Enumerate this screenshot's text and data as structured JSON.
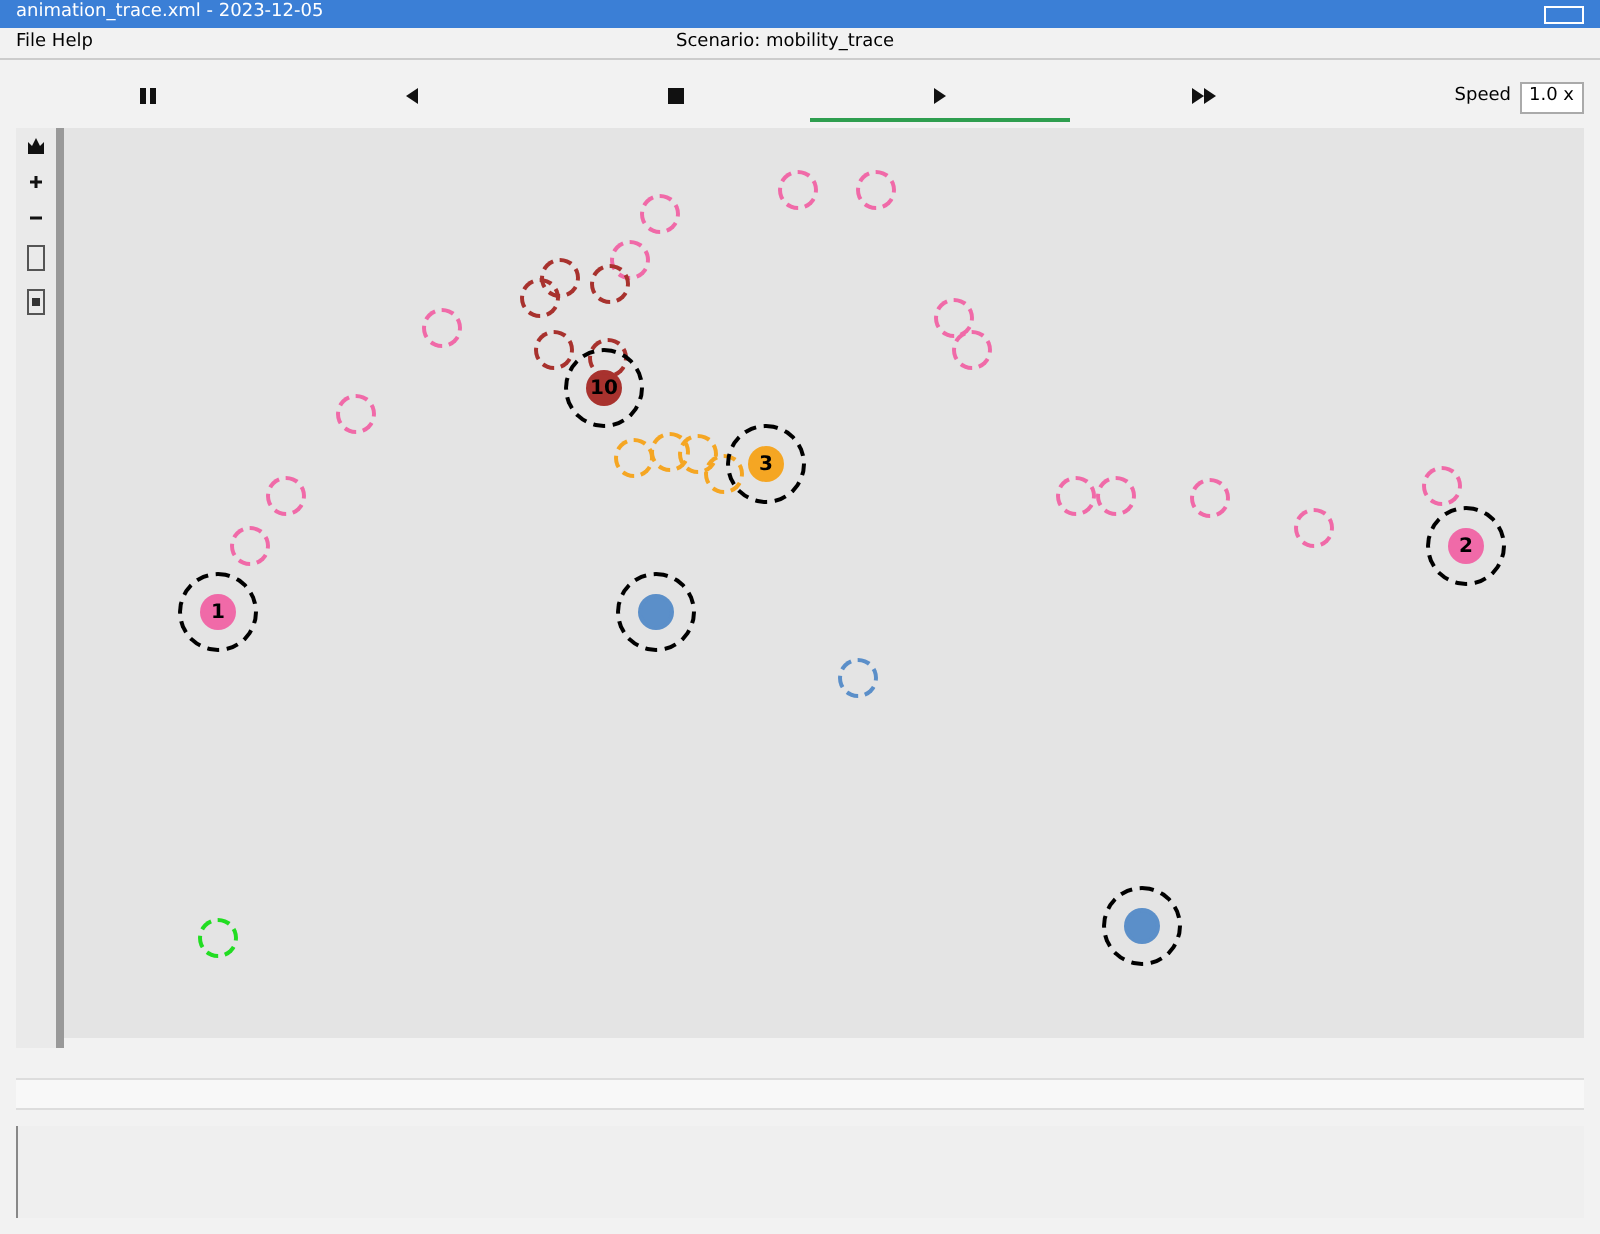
{
  "window": {
    "title": "animation_trace.xml - 2023-12-05"
  },
  "menu": {
    "left": "File  Help",
    "center": "Scenario: mobility_trace"
  },
  "toolbar": [
    {
      "kind": "pause",
      "selected": false
    },
    {
      "kind": "back",
      "selected": false
    },
    {
      "kind": "stop",
      "selected": false
    },
    {
      "kind": "play",
      "selected": true
    },
    {
      "kind": "forward",
      "selected": false
    }
  ],
  "speed": {
    "label": "Speed",
    "value": "1.0 x"
  },
  "nodes": [
    {
      "color": "#f06aa8",
      "filled": false,
      "ringed": false
    },
    {
      "color": "#f06aa8",
      "filled": false,
      "ringed": false
    },
    {
      "color": "#f06aa8",
      "filled": false,
      "ringed": false
    },
    {
      "color": "#f06aa8",
      "filled": false,
      "ringed": false
    },
    {
      "color": "#f06aa8",
      "filled": false,
      "ringed": false
    },
    {
      "color": "#f06aa8",
      "filled": false,
      "ringed": false
    },
    {
      "color": "#f06aa8",
      "filled": false,
      "ringed": false
    },
    {
      "color": "#f06aa8",
      "filled": false,
      "ringed": false
    },
    {
      "color": "#f06aa8",
      "filled": false,
      "ringed": false
    },
    {
      "color": "#f06aa8",
      "filled": false,
      "ringed": false
    },
    {
      "color": "#f06aa8",
      "filled": false,
      "ringed": false
    },
    {
      "color": "#f06aa8",
      "filled": false,
      "ringed": false
    },
    {
      "color": "#f06aa8",
      "filled": false,
      "ringed": false
    },
    {
      "color": "#f06aa8",
      "filled": false,
      "ringed": false
    },
    {
      "color": "#f06aa8",
      "filled": false,
      "ringed": false
    },
    {
      "color": "#f06aa8",
      "filled": true,
      "ringed": true,
      "label": "1"
    },
    {
      "color": "#f06aa8",
      "filled": true,
      "ringed": true,
      "label": "2"
    },
    {
      "color": "#a8322e",
      "filled": false,
      "ringed": false
    },
    {
      "color": "#a8322e",
      "filled": false,
      "ringed": false
    },
    {
      "color": "#a8322e",
      "filled": false,
      "ringed": false
    },
    {
      "color": "#a8322e",
      "filled": false,
      "ringed": false
    },
    {
      "color": "#a8322e",
      "filled": false,
      "ringed": false
    },
    {
      "color": "#a8322e",
      "filled": true,
      "ringed": true,
      "label": "10"
    },
    {
      "color": "#f5a623",
      "filled": false,
      "ringed": false
    },
    {
      "color": "#f5a623",
      "filled": false,
      "ringed": false
    },
    {
      "color": "#f5a623",
      "filled": false,
      "ringed": false
    },
    {
      "color": "#f5a623",
      "filled": false,
      "ringed": false
    },
    {
      "color": "#f5a623",
      "filled": true,
      "ringed": true,
      "label": "3"
    },
    {
      "color": "#5b8fc9",
      "filled": true,
      "ringed": true
    },
    {
      "color": "#5b8fc9",
      "filled": false,
      "ringed": false
    },
    {
      "color": "#5b8fc9",
      "filled": true,
      "ringed": true
    },
    {
      "color": "#22dd22",
      "filled": false,
      "ringed": false
    }
  ]
}
